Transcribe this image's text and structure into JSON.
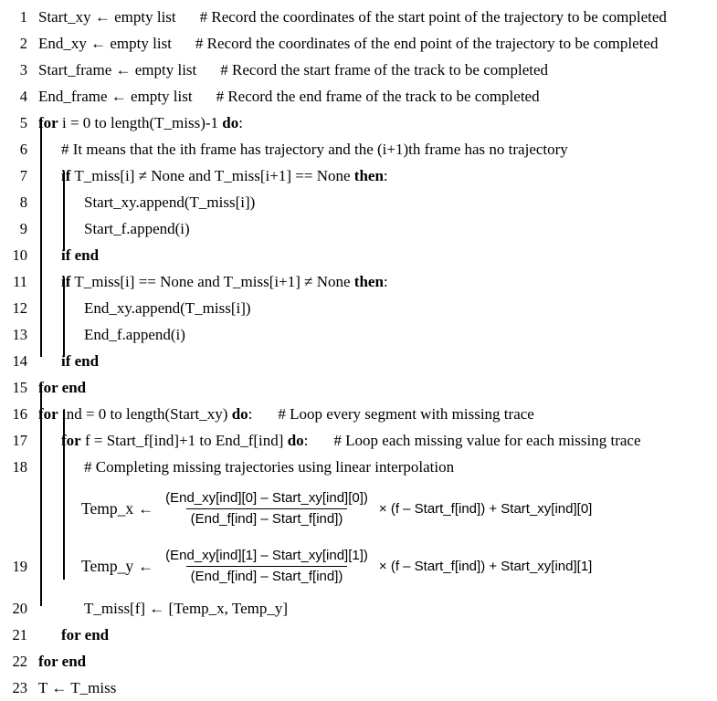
{
  "algorithm": {
    "title": "Trajectory completion pseudocode",
    "symbols": {
      "assign_arrow": "←",
      "not_equal": "≠",
      "multiply": "×",
      "minus": "–"
    },
    "lines": [
      {
        "no": "1",
        "indent": 0,
        "code": "Start_xy ← empty list",
        "comment": "# Record the coordinates of the start point of the trajectory to be completed"
      },
      {
        "no": "2",
        "indent": 0,
        "code": "End_xy ← empty list",
        "comment": "# Record the coordinates of the end point of the trajectory to be completed"
      },
      {
        "no": "3",
        "indent": 0,
        "code": "Start_frame ← empty list",
        "comment": "# Record the start frame of the track to be completed"
      },
      {
        "no": "4",
        "indent": 0,
        "code": "End_frame ← empty list",
        "comment": "# Record the end frame of the track to be completed"
      },
      {
        "no": "5",
        "indent": 0,
        "kw_start": "for",
        "code": " i = 0 to length(T_miss)-1 ",
        "kw_end": "do",
        "code_tail": ":"
      },
      {
        "no": "6",
        "indent": 1,
        "comment": "# It means that the ith frame has trajectory and the (i+1)th frame has no trajectory"
      },
      {
        "no": "7",
        "indent": 1,
        "kw_start": "if",
        "code": " T_miss[i]  ≠  None and T_miss[i+1] == None ",
        "kw_end": "then",
        "code_tail": ":"
      },
      {
        "no": "8",
        "indent": 2,
        "code": "Start_xy.append(T_miss[i])"
      },
      {
        "no": "9",
        "indent": 2,
        "code": "Start_f.append(i)"
      },
      {
        "no": "10",
        "indent": 1,
        "bold_all": "if end"
      },
      {
        "no": "11",
        "indent": 1,
        "kw_start": "if",
        "code": " T_miss[i] == None and T_miss[i+1]  ≠  None ",
        "kw_end": "then",
        "code_tail": ":"
      },
      {
        "no": "12",
        "indent": 2,
        "code": "End_xy.append(T_miss[i])"
      },
      {
        "no": "13",
        "indent": 2,
        "code": "End_f.append(i)"
      },
      {
        "no": "14",
        "indent": 1,
        "bold_all": "if end"
      },
      {
        "no": "15",
        "indent": 0,
        "bold_all": "for end"
      },
      {
        "no": "16",
        "indent": 0,
        "kw_start": "for",
        "code": " ind = 0 to length(Start_xy) ",
        "kw_end": "do",
        "code_tail": ":",
        "comment": "# Loop every segment with missing trace"
      },
      {
        "no": "17",
        "indent": 1,
        "kw_start": "for",
        "code": " f = Start_f[ind]+1 to End_f[ind] ",
        "kw_end": "do",
        "code_tail": ":",
        "comment": "# Loop each missing value for each missing trace"
      },
      {
        "no": "18",
        "indent": 2,
        "comment": "# Completing missing trajectories using linear interpolation"
      },
      {
        "no": "20",
        "indent": 2,
        "code": "T_miss[f]  ←  [Temp_x, Temp_y]"
      },
      {
        "no": "21",
        "indent": 1,
        "bold_all": "for end"
      },
      {
        "no": "22",
        "indent": 0,
        "bold_all": "for end"
      },
      {
        "no": "23",
        "indent": 0,
        "code": "T ← T_miss"
      }
    ],
    "formulas": [
      {
        "no": "18",
        "var": "Temp_x",
        "arrow": "←",
        "numerator": "(End_xy[ind][0] – Start_xy[ind][0])",
        "denominator": "(End_f[ind] – Start_f[ind])",
        "tail": "× (f – Start_f[ind]) + Start_xy[ind][0]"
      },
      {
        "no": "19",
        "var": "Temp_y",
        "arrow": "←",
        "numerator": "(End_xy[ind][1] – Start_xy[ind][1])",
        "denominator": "(End_f[ind] – Start_f[ind])",
        "tail": "× (f – Start_f[ind]) + Start_xy[ind][1]"
      }
    ]
  }
}
